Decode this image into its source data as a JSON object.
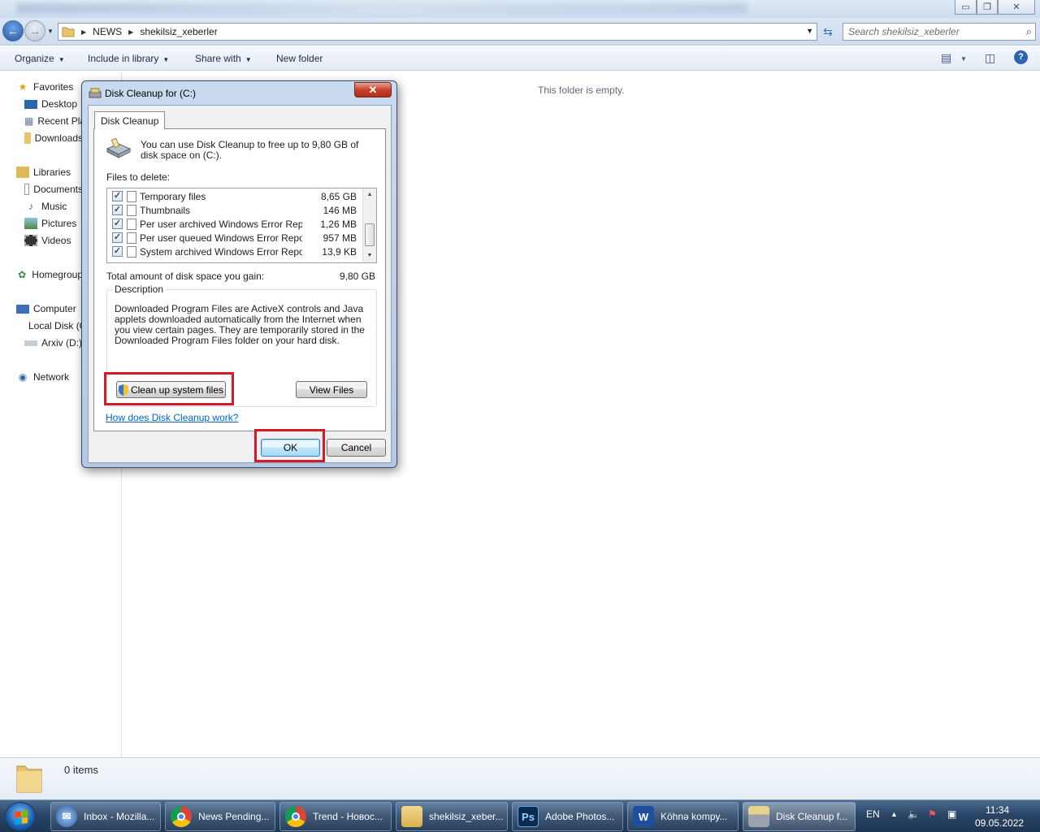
{
  "explorer": {
    "address": {
      "crumbs": [
        "NEWS",
        "shekilsiz_xeberler"
      ],
      "search_placeholder": "Search shekilsiz_xeberler"
    },
    "toolbar": {
      "organize": "Organize",
      "include_in_library": "Include in library",
      "share_with": "Share with",
      "new_folder": "New folder"
    },
    "nav": {
      "favorites": "Favorites",
      "desktop": "Desktop",
      "recent_places": "Recent Places",
      "downloads": "Downloads",
      "libraries": "Libraries",
      "documents": "Documents",
      "music": "Music",
      "pictures": "Pictures",
      "videos": "Videos",
      "homegroup": "Homegroup",
      "computer": "Computer",
      "local_disk": "Local Disk (C:)",
      "arxiv": "Arxiv (D:)",
      "network": "Network"
    },
    "empty_message": "This folder is empty.",
    "details_count": "0 items"
  },
  "dialog": {
    "title": "Disk Cleanup for  (C:)",
    "tab": "Disk Cleanup",
    "intro": "You can use Disk Cleanup to free up to 9,80 GB of disk space on  (C:).",
    "files_to_delete_label": "Files to delete:",
    "files": [
      {
        "name": "Temporary files",
        "size": "8,65 GB",
        "checked": true
      },
      {
        "name": "Thumbnails",
        "size": "146 MB",
        "checked": true
      },
      {
        "name": "Per user archived Windows Error Repo...",
        "size": "1,26 MB",
        "checked": true
      },
      {
        "name": "Per user queued Windows Error Repor...",
        "size": "957 MB",
        "checked": true
      },
      {
        "name": "System archived Windows Error Repor...",
        "size": "13,9 KB",
        "checked": true
      }
    ],
    "total_label": "Total amount of disk space you gain:",
    "total_value": "9,80 GB",
    "description_title": "Description",
    "description": "Downloaded Program Files are ActiveX controls and Java applets downloaded automatically from the Internet when you view certain pages. They are temporarily stored in the Downloaded Program Files folder on your hard disk.",
    "cleanup_system_files": "Clean up system files",
    "view_files": "View Files",
    "help_link": "How does Disk Cleanup work?",
    "ok": "OK",
    "cancel": "Cancel"
  },
  "taskbar": {
    "tasks": [
      {
        "label": "Inbox - Mozilla...",
        "icon": "thunderbird-icon"
      },
      {
        "label": "News Pending...",
        "icon": "chrome-icon"
      },
      {
        "label": "Trend - Новос...",
        "icon": "chrome-icon"
      },
      {
        "label": "shekilsiz_xeber...",
        "icon": "folder-icon"
      },
      {
        "label": "Adobe Photos...",
        "icon": "photoshop-icon"
      },
      {
        "label": "Köhnə kompy...",
        "icon": "word-icon"
      },
      {
        "label": "Disk Cleanup f...",
        "icon": "disk-cleanup-icon"
      }
    ],
    "language": "EN",
    "time": "11:34",
    "date": "09.05.2022"
  },
  "colors": {
    "highlight": "#d11a2a",
    "link": "#0066cc"
  }
}
